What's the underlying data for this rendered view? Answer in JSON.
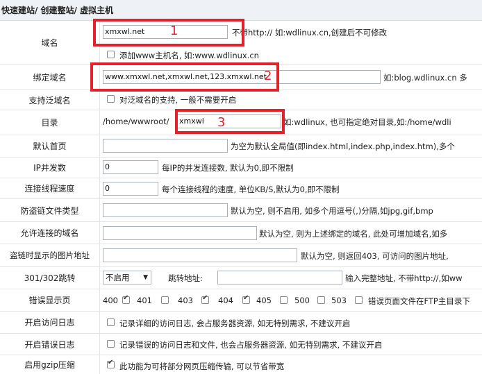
{
  "breadcrumb": "快速建站/ 创建整站/ 虚拟主机",
  "domain": {
    "label": "域名",
    "value": "xmxwl.net",
    "hint": "不带http:// 如:wdlinux.cn,创建后不可修改",
    "add_www_label": "添加www主机名, 如:www.wdlinux.cn"
  },
  "bind_domain": {
    "label": "绑定域名",
    "value": "www.xmxwl.net,xmxwl.net,123.xmxwl.net",
    "hint": "如:blog.wdlinux.cn 多"
  },
  "wildcard": {
    "label": "支持泛域名",
    "checkbox_label": "对泛域名的支持, 一般不需要开启"
  },
  "directory": {
    "label": "目录",
    "prefix": "/home/wwwroot/",
    "value": "xmxwl",
    "hint": "如:wdlinux, 也可指定绝对目录,如:/home/wdli"
  },
  "default_page": {
    "label": "默认首页",
    "value": "",
    "hint": "为空为默认全局值(即index.html,index.php,index.htm),多个"
  },
  "ip_concurrency": {
    "label": "IP并发数",
    "value": "0",
    "hint": "每IP的并发连接数, 默认为0,即不限制"
  },
  "thread_speed": {
    "label": "连接线程速度",
    "value": "0",
    "hint": "每个连接线程的速度, 单位KB/S,默认为0,即不限制"
  },
  "hotlink_types": {
    "label": "防盗链文件类型",
    "value": "",
    "hint": "默认为空, 则不启用, 如多个用逗号(,)分隔,如jpg,gif,bmp"
  },
  "allowed_domains": {
    "label": "允许连接的域名",
    "value": "",
    "hint": "默认为空, 则为上述绑定的域名, 此处可增加域名,如多"
  },
  "hotlink_image": {
    "label": "盗链时显示的图片地址",
    "value": "",
    "hint": "默认为空, 则返回403, 可访问的图片地址, "
  },
  "redirect": {
    "label": "301/302跳转",
    "select_value": "不启用",
    "address_label": "跳转地址:",
    "address_value": "",
    "hint": "输入完整地址, 不带http://,如ww"
  },
  "error_pages": {
    "label": "错误显示页",
    "items": [
      {
        "code": "400",
        "checked": true
      },
      {
        "code": "401",
        "checked": false
      },
      {
        "code": "403",
        "checked": true
      },
      {
        "code": "404",
        "checked": true
      },
      {
        "code": "405",
        "checked": false
      },
      {
        "code": "500",
        "checked": false
      },
      {
        "code": "503",
        "checked": false
      }
    ],
    "hint": "错误页面文件在FTP主目录下"
  },
  "access_log": {
    "label": "开启访问日志",
    "checkbox_label": "记录详细的访问日志, 会占服务器资源, 如无特别需求, 不建议开启"
  },
  "error_log": {
    "label": "开启错误日志",
    "checkbox_label": "记录错误的访问日志和文件, 也会占服务器资源, 如无特别需求, 不建议开启"
  },
  "gzip": {
    "label": "启用gzip压缩",
    "checkbox_label": "此功能为可将部分网页压缩传输, 可以节省带宽"
  },
  "annotations": [
    "1",
    "2",
    "3"
  ]
}
